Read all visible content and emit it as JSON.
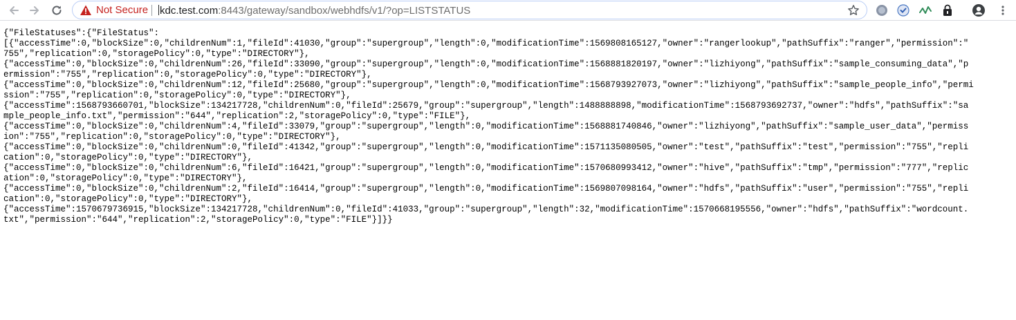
{
  "browser": {
    "security_label": "Not Secure",
    "url_host": "kdc.test.com",
    "url_rest": ":8443/gateway/sandbox/webhdfs/v1/?op=LISTSTATUS",
    "icons": [
      "back-arrow-icon",
      "forward-arrow-icon",
      "reload-icon",
      "warning-triangle-icon",
      "star-icon",
      "extension-circle-icon",
      "extension-shield-icon",
      "extension-wave-icon",
      "extension-lock-icon",
      "profile-icon",
      "menu-dots-icon"
    ],
    "colors": {
      "warning": "#c5221f",
      "url_text": "#6e6e6e",
      "host_text": "#202124"
    }
  },
  "json_lines": [
    "{\"FileStatuses\":{\"FileStatus\":",
    "[{\"accessTime\":0,\"blockSize\":0,\"childrenNum\":1,\"fileId\":41030,\"group\":\"supergroup\",\"length\":0,\"modificationTime\":1569808165127,\"owner\":\"rangerlookup\",\"pathSuffix\":\"ranger\",\"permission\":\"",
    "755\",\"replication\":0,\"storagePolicy\":0,\"type\":\"DIRECTORY\"},",
    "{\"accessTime\":0,\"blockSize\":0,\"childrenNum\":26,\"fileId\":33090,\"group\":\"supergroup\",\"length\":0,\"modificationTime\":1568881820197,\"owner\":\"lizhiyong\",\"pathSuffix\":\"sample_consuming_data\",\"p",
    "ermission\":\"755\",\"replication\":0,\"storagePolicy\":0,\"type\":\"DIRECTORY\"},",
    "{\"accessTime\":0,\"blockSize\":0,\"childrenNum\":12,\"fileId\":25680,\"group\":\"supergroup\",\"length\":0,\"modificationTime\":1568793927073,\"owner\":\"lizhiyong\",\"pathSuffix\":\"sample_people_info\",\"permi",
    "ssion\":\"755\",\"replication\":0,\"storagePolicy\":0,\"type\":\"DIRECTORY\"},",
    "{\"accessTime\":1568793660701,\"blockSize\":134217728,\"childrenNum\":0,\"fileId\":25679,\"group\":\"supergroup\",\"length\":1488888898,\"modificationTime\":1568793692737,\"owner\":\"hdfs\",\"pathSuffix\":\"sa",
    "mple_people_info.txt\",\"permission\":\"644\",\"replication\":2,\"storagePolicy\":0,\"type\":\"FILE\"},",
    "{\"accessTime\":0,\"blockSize\":0,\"childrenNum\":4,\"fileId\":33079,\"group\":\"supergroup\",\"length\":0,\"modificationTime\":1568881740846,\"owner\":\"lizhiyong\",\"pathSuffix\":\"sample_user_data\",\"permiss",
    "ion\":\"755\",\"replication\":0,\"storagePolicy\":0,\"type\":\"DIRECTORY\"},",
    "{\"accessTime\":0,\"blockSize\":0,\"childrenNum\":0,\"fileId\":41342,\"group\":\"supergroup\",\"length\":0,\"modificationTime\":1571135080505,\"owner\":\"test\",\"pathSuffix\":\"test\",\"permission\":\"755\",\"repli",
    "cation\":0,\"storagePolicy\":0,\"type\":\"DIRECTORY\"},",
    "{\"accessTime\":0,\"blockSize\":0,\"childrenNum\":6,\"fileId\":16421,\"group\":\"supergroup\",\"length\":0,\"modificationTime\":1570680993412,\"owner\":\"hive\",\"pathSuffix\":\"tmp\",\"permission\":\"777\",\"replic",
    "ation\":0,\"storagePolicy\":0,\"type\":\"DIRECTORY\"},",
    "{\"accessTime\":0,\"blockSize\":0,\"childrenNum\":2,\"fileId\":16414,\"group\":\"supergroup\",\"length\":0,\"modificationTime\":1569807098164,\"owner\":\"hdfs\",\"pathSuffix\":\"user\",\"permission\":\"755\",\"repli",
    "cation\":0,\"storagePolicy\":0,\"type\":\"DIRECTORY\"},",
    "{\"accessTime\":1570679736915,\"blockSize\":134217728,\"childrenNum\":0,\"fileId\":41033,\"group\":\"supergroup\",\"length\":32,\"modificationTime\":1570668195556,\"owner\":\"hdfs\",\"pathSuffix\":\"wordcount.",
    "txt\",\"permission\":\"644\",\"replication\":2,\"storagePolicy\":0,\"type\":\"FILE\"}]}}"
  ]
}
